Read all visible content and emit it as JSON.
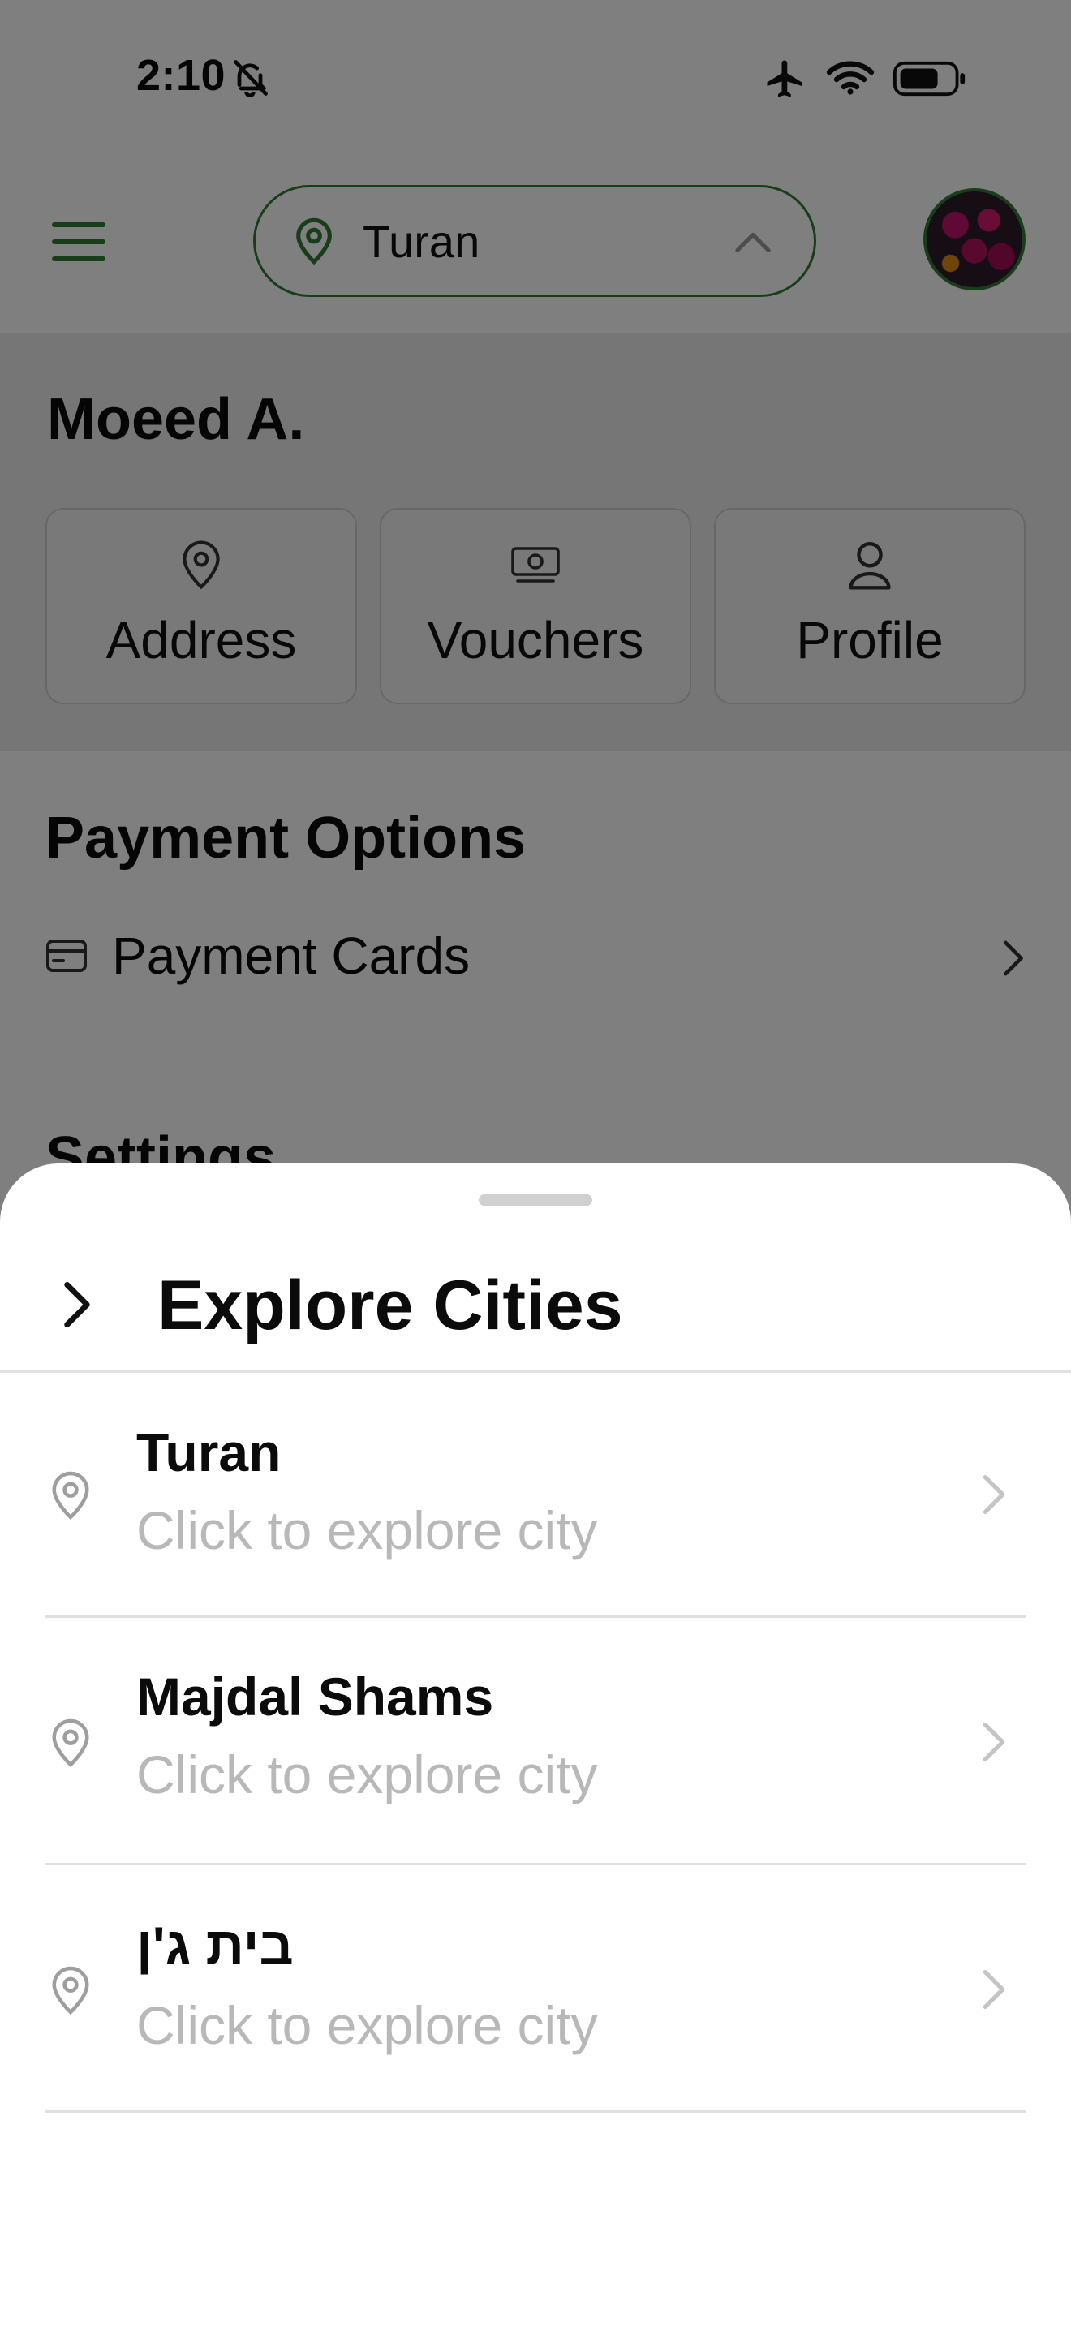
{
  "status_bar": {
    "time": "2:10",
    "icons": [
      "bell-slash-icon",
      "airplane-icon",
      "wifi-icon",
      "battery-icon"
    ]
  },
  "top_nav": {
    "menu_icon": "hamburger-icon",
    "selected_city": "Turan",
    "selector_icons": [
      "map-pin-icon",
      "chevron-up-icon"
    ],
    "accent_color": "#2e7d32"
  },
  "account": {
    "user_name": "Moeed A.",
    "quick_actions": [
      {
        "label": "Address",
        "icon": "map-pin-icon"
      },
      {
        "label": "Vouchers",
        "icon": "banknote-icon"
      },
      {
        "label": "Profile",
        "icon": "person-icon"
      }
    ]
  },
  "payment": {
    "title": "Payment Options",
    "items": [
      {
        "label": "Payment Cards",
        "icon": "credit-card-icon"
      }
    ]
  },
  "settings": {
    "title": "Settings"
  },
  "sheet": {
    "title": "Explore Cities",
    "back_icon": "chevron-right-icon",
    "cities": [
      {
        "name": "Turan",
        "subtitle": "Click to explore city"
      },
      {
        "name": "Majdal Shams",
        "subtitle": "Click to explore city"
      },
      {
        "name": "בית ג'ן",
        "subtitle": "Click to explore city"
      }
    ]
  }
}
